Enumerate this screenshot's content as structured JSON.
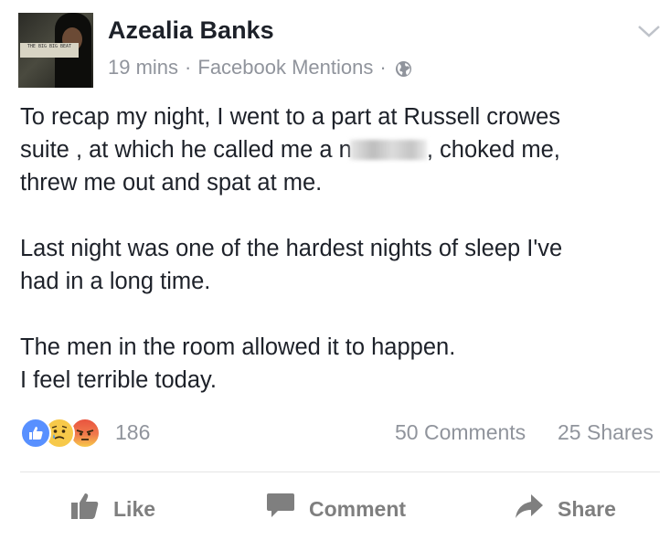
{
  "post": {
    "author": "Azealia Banks",
    "time": "19 mins",
    "via": "Facebook Mentions",
    "separator": "·",
    "avatar_text": "THE BIG BIG BEAT",
    "paragraph1_before": "To recap my night, I went to a part at Russell crowes\nsuite , at which he called me a n",
    "paragraph1_after": ", choked me,\nthrew me out and spat at me.",
    "paragraph2": "Last night was one of the hardest nights of sleep I've\nhad in a long time.",
    "paragraph3": "The men in the room allowed it to happen.\nI feel terrible today."
  },
  "stats": {
    "reaction_count": "186",
    "comments": "50 Comments",
    "shares": "25 Shares",
    "reactions": [
      "like",
      "sad",
      "angry"
    ]
  },
  "actions": {
    "like": "Like",
    "comment": "Comment",
    "share": "Share"
  },
  "colors": {
    "text": "#1d2129",
    "meta": "#90949c",
    "action": "#7f7f7f",
    "like_blue": "#5890ff",
    "emoji_yellow": "#f7c94a",
    "angry_red": "#e9543f"
  },
  "icons": {
    "audience": "globe-icon",
    "menu": "chevron-down-icon",
    "like": "thumbs-up-icon",
    "comment": "speech-bubble-icon",
    "share": "share-arrow-icon"
  }
}
